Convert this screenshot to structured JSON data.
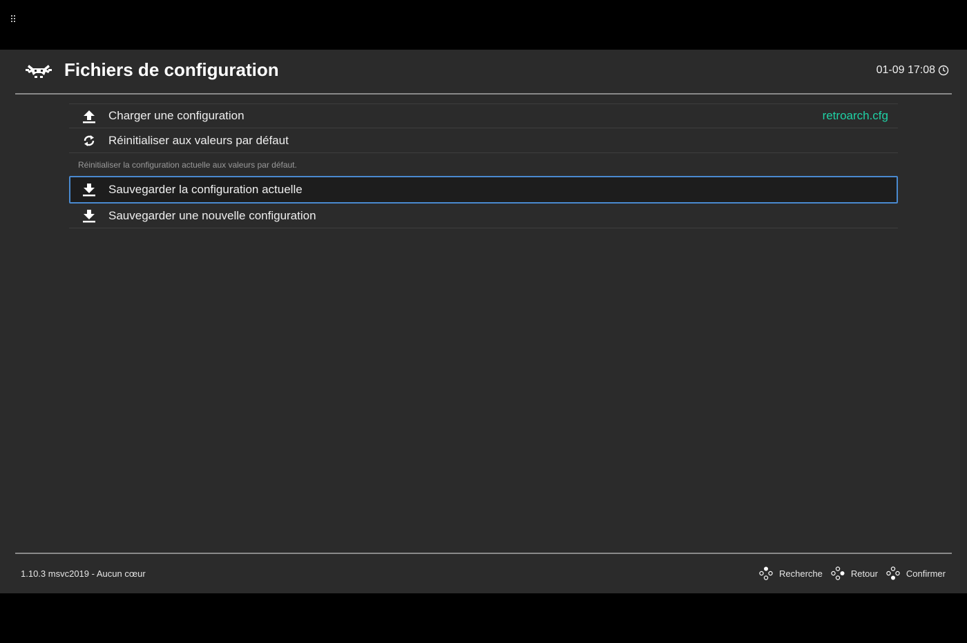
{
  "header": {
    "title": "Fichiers de configuration",
    "clock": "01-09 17:08"
  },
  "menu": {
    "items": [
      {
        "label": "Charger une configuration",
        "value": "retroarch.cfg",
        "icon": "upload-icon"
      },
      {
        "label": "Réinitialiser aux valeurs par défaut",
        "sublabel": "Réinitialiser la configuration actuelle aux valeurs par défaut.",
        "icon": "refresh-icon"
      },
      {
        "label": "Sauvegarder la configuration actuelle",
        "icon": "download-icon",
        "selected": true
      },
      {
        "label": "Sauvegarder une nouvelle configuration",
        "icon": "download-icon"
      }
    ]
  },
  "footer": {
    "version": "1.10.3 msvc2019 - Aucun cœur",
    "hints": [
      {
        "label": "Recherche",
        "icon": "gamepad-button-top-icon"
      },
      {
        "label": "Retour",
        "icon": "gamepad-button-right-icon"
      },
      {
        "label": "Confirmer",
        "icon": "gamepad-button-bottom-icon"
      }
    ]
  },
  "colors": {
    "accent_value": "#1fd1a5",
    "selection_border": "#4a8ad0",
    "background": "#2b2b2b"
  }
}
